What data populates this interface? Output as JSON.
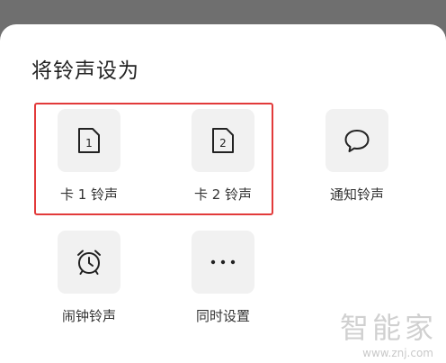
{
  "dialog": {
    "title": "将铃声设为",
    "options": [
      {
        "label": "卡 1 铃声",
        "icon": "sim-card-1-icon",
        "icon_text": "1"
      },
      {
        "label": "卡 2 铃声",
        "icon": "sim-card-2-icon",
        "icon_text": "2"
      },
      {
        "label": "通知铃声",
        "icon": "message-bubble-icon"
      },
      {
        "label": "闹钟铃声",
        "icon": "alarm-clock-icon"
      },
      {
        "label": "同时设置",
        "icon": "more-dots-icon"
      }
    ]
  },
  "watermark": {
    "brand": "智能家",
    "url": "www.znj.com"
  },
  "colors": {
    "highlight_border": "#e23a3a",
    "tile_background": "#f1f1f1",
    "overlay": "#6f6f6f"
  }
}
